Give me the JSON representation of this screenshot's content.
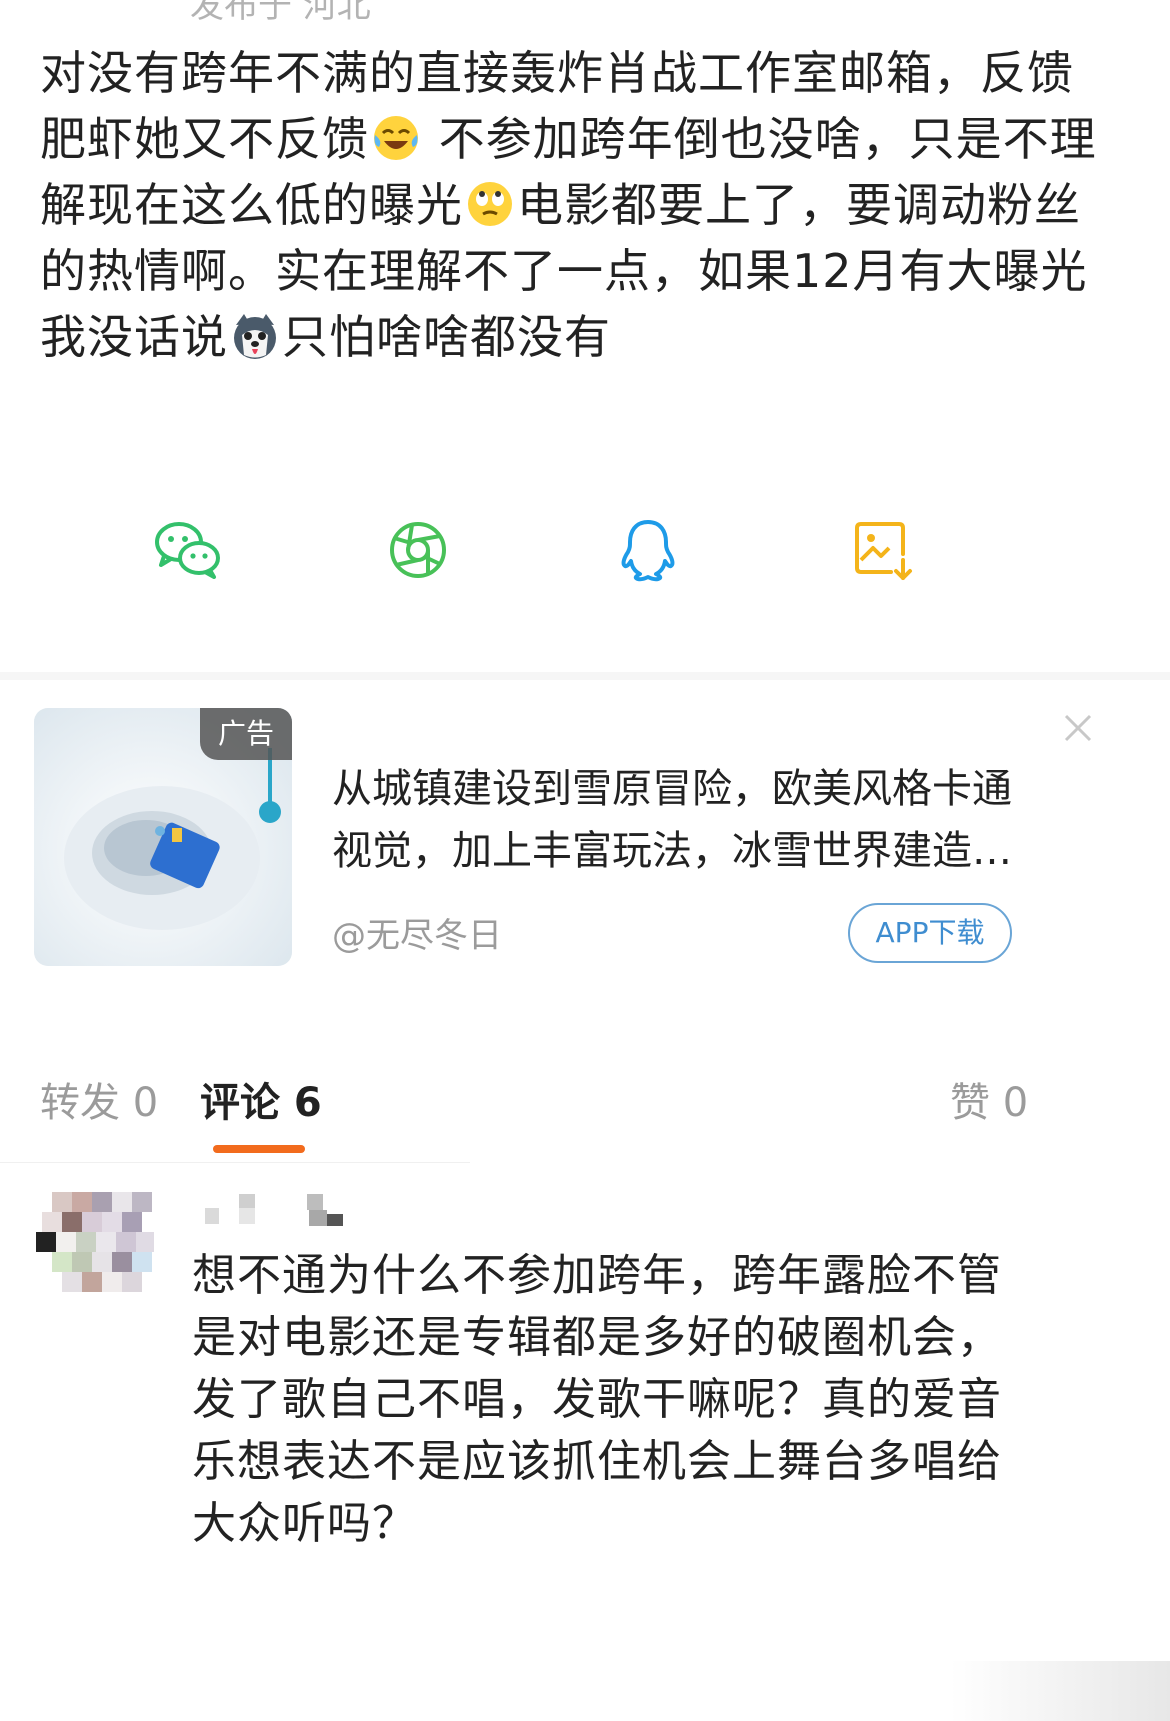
{
  "post": {
    "location": "发布于 河北",
    "segments": [
      "对没有跨年不满的直接轰炸肖战工作室邮箱，反馈肥虾她又不反馈",
      " 不参加跨年倒也没啥，只是不理解现在这么低的曝光",
      "电影都要上了，要调动粉丝的热情啊。实在理解不了一点，如果12月有大曝光我没话说",
      "只怕啥啥都没有"
    ],
    "emojis": [
      "crying-laughing-emoji",
      "rolling-eyes-emoji",
      "husky-dog-emoji"
    ]
  },
  "share": {
    "items": [
      {
        "name": "wechat-icon",
        "color": "#33c06b"
      },
      {
        "name": "moments-icon",
        "color": "#48c158"
      },
      {
        "name": "qq-icon",
        "color": "#1e9be8"
      },
      {
        "name": "save-image-icon",
        "color": "#f4b41a"
      }
    ]
  },
  "ad": {
    "badge": "广告",
    "text": "从城镇建设到雪原冒险，欧美风格卡通视觉，加上丰富玩法，冰雪世界建造经营",
    "source": "@无尽冬日",
    "button": "APP下载"
  },
  "tabs": {
    "repost": "转发 0",
    "comments": "评论 6",
    "likes": "赞 0",
    "active_color": "#f26b1d"
  },
  "comment": {
    "text": "想不通为什么不参加跨年，跨年露脸不管是对电影还是专辑都是多好的破圈机会，发了歌自己不唱，发歌干嘛呢？真的爱音乐想表达不是应该抓住机会上舞台多唱给大众听吗？"
  }
}
